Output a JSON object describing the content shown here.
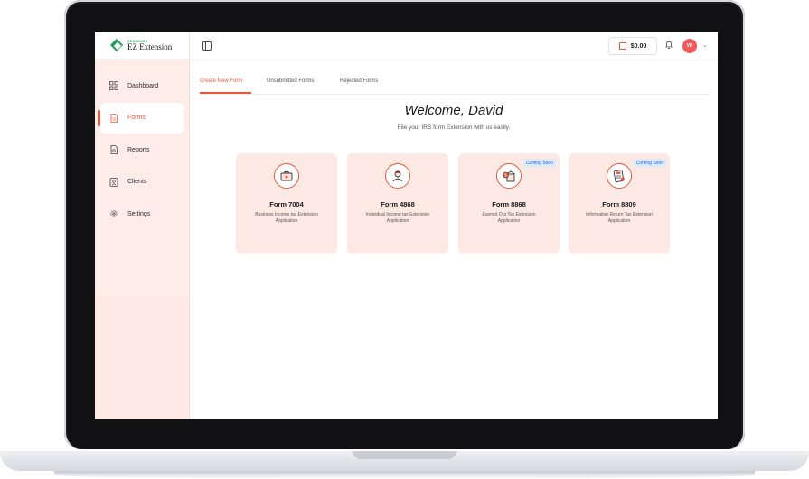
{
  "app": {
    "logo_small": "ZENWORK",
    "logo_name": "EZ Extension"
  },
  "sidebar": {
    "items": [
      {
        "label": "Dashboard",
        "icon": "grid-icon",
        "active": false
      },
      {
        "label": "Forms",
        "icon": "document-icon",
        "active": true
      },
      {
        "label": "Reports",
        "icon": "report-icon",
        "active": false
      },
      {
        "label": "Clients",
        "icon": "contact-card-icon",
        "active": false
      },
      {
        "label": "Settings",
        "icon": "gear-icon",
        "active": false
      }
    ]
  },
  "header": {
    "balance": "$0.00",
    "avatar_initials": "VP"
  },
  "tabs": [
    {
      "label": "Create New Form",
      "active": true
    },
    {
      "label": "Unsubmitted Forms",
      "active": false
    },
    {
      "label": "Rejected Forms",
      "active": false
    }
  ],
  "main": {
    "welcome": "Welcome, David",
    "subtitle": "File your IRS form Extension with us easily."
  },
  "cards": [
    {
      "title": "Form 7004",
      "desc": "Business Income tax Extension Application",
      "badge": "",
      "icon": "briefcase-icon"
    },
    {
      "title": "Form 4868",
      "desc": "Individual Income tax Extension Application",
      "badge": "",
      "icon": "person-icon"
    },
    {
      "title": "Form 8868",
      "desc": "Exempt Org Tax Extension Application",
      "badge": "Coming Soon",
      "icon": "dollar-building-icon"
    },
    {
      "title": "Form 8809",
      "desc": "Information Return Tax Extension Application",
      "badge": "Coming Soon",
      "icon": "tax-document-icon"
    }
  ],
  "colors": {
    "accent": "#e8573c",
    "sidebar_bg": "#fdece8",
    "card_bg": "#fde9e4",
    "brand_green": "#1e9e5a",
    "badge_blue": "#2563eb"
  }
}
